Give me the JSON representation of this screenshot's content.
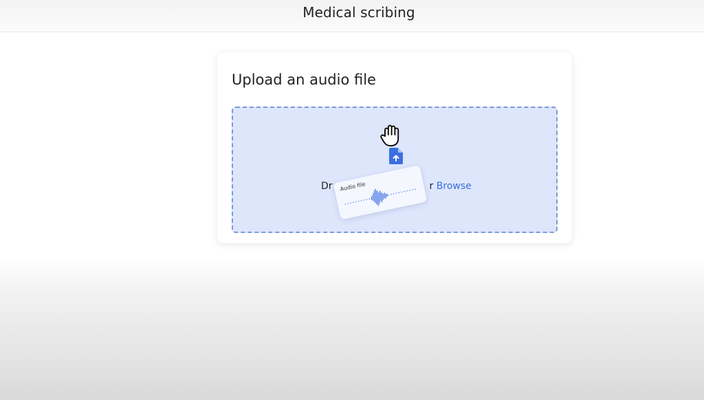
{
  "header": {
    "title": "Medical scribing"
  },
  "upload": {
    "title": "Upload an audio file",
    "drop_text_prefix": "Dr",
    "drop_text_suffix": "r ",
    "browse_label": "Browse"
  },
  "drag_preview": {
    "label": "Audio file"
  },
  "icons": {
    "hand": "grab-hand-icon",
    "file": "file-upload-icon",
    "waveform": "audio-waveform-icon"
  },
  "colors": {
    "dropzone_bg": "#dde6fb",
    "dropzone_border": "#7a99d6",
    "accent": "#3c6fe0"
  }
}
